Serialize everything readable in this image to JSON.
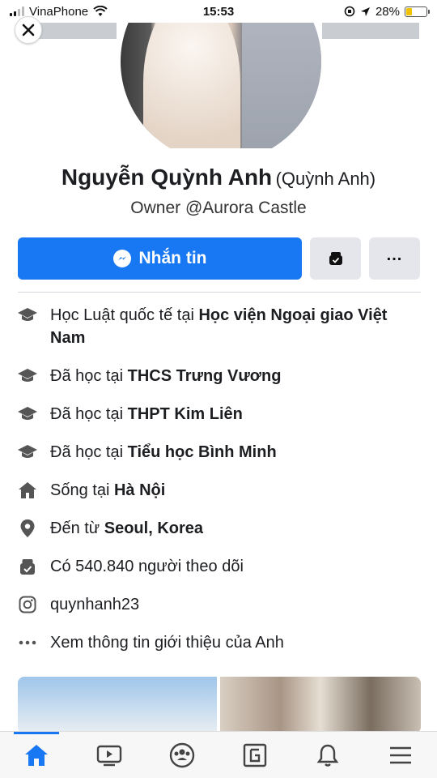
{
  "status_bar": {
    "carrier": "VinaPhone",
    "time": "15:53",
    "battery": "28%",
    "battery_level": 0.28
  },
  "profile": {
    "name": "Nguyễn Quỳnh Anh",
    "alternate_name": "(Quỳnh Anh)",
    "bio": "Owner @Aurora Castle"
  },
  "actions": {
    "message_label": "Nhắn tin"
  },
  "info": [
    {
      "icon": "graduation-cap-icon",
      "prefix": "Học Luật quốc tế tại ",
      "bold": "Học viện Ngoại giao Việt Nam",
      "suffix": ""
    },
    {
      "icon": "graduation-cap-icon",
      "prefix": "Đã học tại ",
      "bold": "THCS Trưng Vương",
      "suffix": ""
    },
    {
      "icon": "graduation-cap-icon",
      "prefix": "Đã học tại ",
      "bold": "THPT Kim Liên",
      "suffix": ""
    },
    {
      "icon": "graduation-cap-icon",
      "prefix": "Đã học tại ",
      "bold": "Tiểu học Bình Minh",
      "suffix": ""
    },
    {
      "icon": "home-icon",
      "prefix": "Sống tại ",
      "bold": "Hà Nội",
      "suffix": ""
    },
    {
      "icon": "location-pin-icon",
      "prefix": "Đến từ ",
      "bold": "Seoul, Korea",
      "suffix": ""
    },
    {
      "icon": "followers-icon",
      "prefix": "Có 540.840 người theo dõi",
      "bold": "",
      "suffix": ""
    },
    {
      "icon": "instagram-icon",
      "prefix": "quynhanh23",
      "bold": "",
      "suffix": ""
    },
    {
      "icon": "more-horizontal-icon",
      "prefix": "Xem thông tin giới thiệu của Anh",
      "bold": "",
      "suffix": ""
    }
  ],
  "colors": {
    "accent": "#1877f2",
    "secondary_button": "#e4e6eb",
    "text": "#1c1e21"
  },
  "bottom_nav": [
    {
      "icon": "home-icon",
      "active": true
    },
    {
      "icon": "video-icon",
      "active": false
    },
    {
      "icon": "groups-icon",
      "active": false
    },
    {
      "icon": "gaming-icon",
      "active": false
    },
    {
      "icon": "bell-icon",
      "active": false
    },
    {
      "icon": "menu-icon",
      "active": false
    }
  ]
}
